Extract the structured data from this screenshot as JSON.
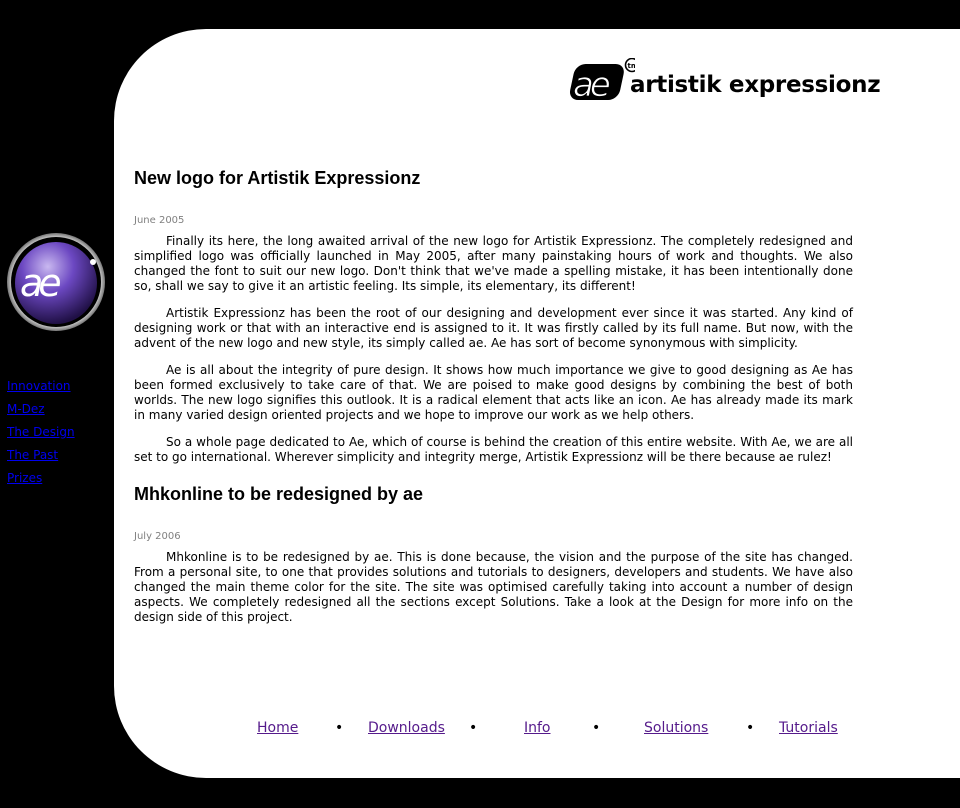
{
  "brand": {
    "logo_text": "artistik expressionz",
    "logo_mark": "ae",
    "tm": "tm"
  },
  "sidebar": {
    "links": [
      {
        "label": "Innovation"
      },
      {
        "label": "M-Dez"
      },
      {
        "label": "The Design"
      },
      {
        "label": "The Past"
      },
      {
        "label": "Prizes"
      }
    ]
  },
  "articles": [
    {
      "title": "New logo for Artistik Expressionz",
      "date": "June 2005",
      "paragraphs": [
        "Finally its here, the long awaited arrival of the new logo for Artistik Expressionz. The completely redesigned and simplified logo was officially launched in May 2005, after many painstaking hours of work and thoughts. We also changed the font to suit our new logo. Don't think that we've made a spelling mistake, it has been intentionally done so, shall we say to give it an artistic feeling. Its simple, its elementary, its different!",
        "Artistik Expressionz has been the root of our designing and development ever since it was started. Any kind of designing work or that with an interactive end is assigned to it. It was firstly called by its full name. But now, with the advent of the new logo and new style, its simply called ae. Ae has sort of become synonymous with simplicity.",
        "Ae is all about  the integrity of pure design. It shows how much importance we give to good designing as Ae has been formed exclusively to take care of that. We are poised to make good designs by combining the best of both worlds. The new logo signifies this outlook. It is a radical element that acts like an icon. Ae has already made its mark in many varied design oriented projects and we hope to improve our work as we help others.",
        "So a whole page dedicated to Ae, which of course is behind the creation of this entire website. With  Ae, we are all set to go international. Wherever simplicity and integrity merge, Artistik Expressionz will be there because ae rulez!"
      ]
    },
    {
      "title": "Mhkonline to be redesigned by ae",
      "date": "July 2006",
      "paragraphs": [
        "Mhkonline is to be redesigned by ae. This is done because, the vision and the purpose of the site has changed. From a personal site, to one that provides solutions and tutorials to designers, developers and students. We have also changed the main theme color for the site. The site was optimised carefully taking into account a number of design aspects. We completely redesigned all the sections except Solutions. Take a look at the Design for more info on the design side of this project."
      ]
    }
  ],
  "footer_nav": {
    "links": [
      {
        "label": "Home"
      },
      {
        "label": "Downloads"
      },
      {
        "label": "Info"
      },
      {
        "label": "Solutions"
      },
      {
        "label": "Tutorials"
      }
    ],
    "separator": "•"
  },
  "colors": {
    "background": "#000000",
    "panel": "#ffffff",
    "link_unvisited": "#0000ee",
    "link_visited": "#551a8b",
    "date": "#808080",
    "orb": "#5b3aa8"
  },
  "icons": {
    "logo": "ae-logo-mark-icon",
    "sidebar_orb": "ae-orb-icon"
  }
}
